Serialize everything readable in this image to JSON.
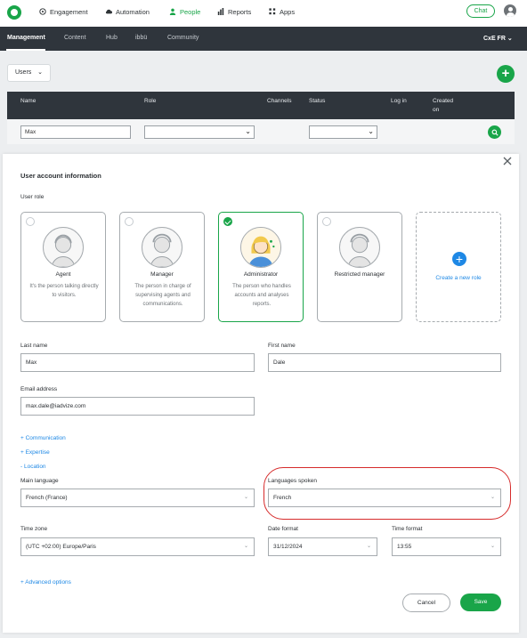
{
  "nav": {
    "items": [
      {
        "label": "Engagement",
        "icon": "compass-icon"
      },
      {
        "label": "Automation",
        "icon": "cloud-icon"
      },
      {
        "label": "People",
        "icon": "person-icon",
        "active": true
      },
      {
        "label": "Reports",
        "icon": "bar-chart-icon"
      },
      {
        "label": "Apps",
        "icon": "grid-icon"
      }
    ],
    "chat_label": "Chat"
  },
  "subnav": {
    "items": [
      "Management",
      "Content",
      "Hub",
      "ibbü",
      "Community"
    ],
    "active": "Management",
    "account": "CxE FR"
  },
  "list": {
    "view_select": "Users",
    "columns": [
      "Name",
      "Role",
      "Channels",
      "Status",
      "Log in",
      "Created on"
    ],
    "filter_name_value": "Max"
  },
  "modal": {
    "title": "User account information",
    "role_section": "User role",
    "roles": [
      {
        "name": "Agent",
        "description": "It's the person talking directly to visitors.",
        "selected": false
      },
      {
        "name": "Manager",
        "description": "The person in charge of supervising agents and communications.",
        "selected": false
      },
      {
        "name": "Administrator",
        "description": "The person who handles accounts and analyses reports.",
        "selected": true
      },
      {
        "name": "Restricted manager",
        "description": "",
        "selected": false
      }
    ],
    "create_role": "Create a new role",
    "last_name_label": "Last name",
    "last_name_value": "Max",
    "first_name_label": "First name",
    "first_name_value": "Dale",
    "email_label": "Email address",
    "email_value": "max.dale@iadvize.com",
    "links": [
      "+ Communication",
      "+ Expertise",
      "- Location"
    ],
    "main_language_label": "Main language",
    "main_language_value": "French (France)",
    "languages_spoken_label": "Languages spoken",
    "languages_spoken_value": "French",
    "time_zone_label": "Time zone",
    "time_zone_value": "(UTC +02:00) Europe/Paris",
    "date_format_label": "Date format",
    "date_format_value": "31/12/2024",
    "time_format_label": "Time format",
    "time_format_value": "13:55",
    "advanced_options": "+ Advanced options",
    "cancel_label": "Cancel",
    "save_label": "Save"
  },
  "colors": {
    "brand_green": "#19a549",
    "dark_header": "#2f353c",
    "link_blue": "#1e88e5",
    "highlight_red": "#d62b2b"
  }
}
